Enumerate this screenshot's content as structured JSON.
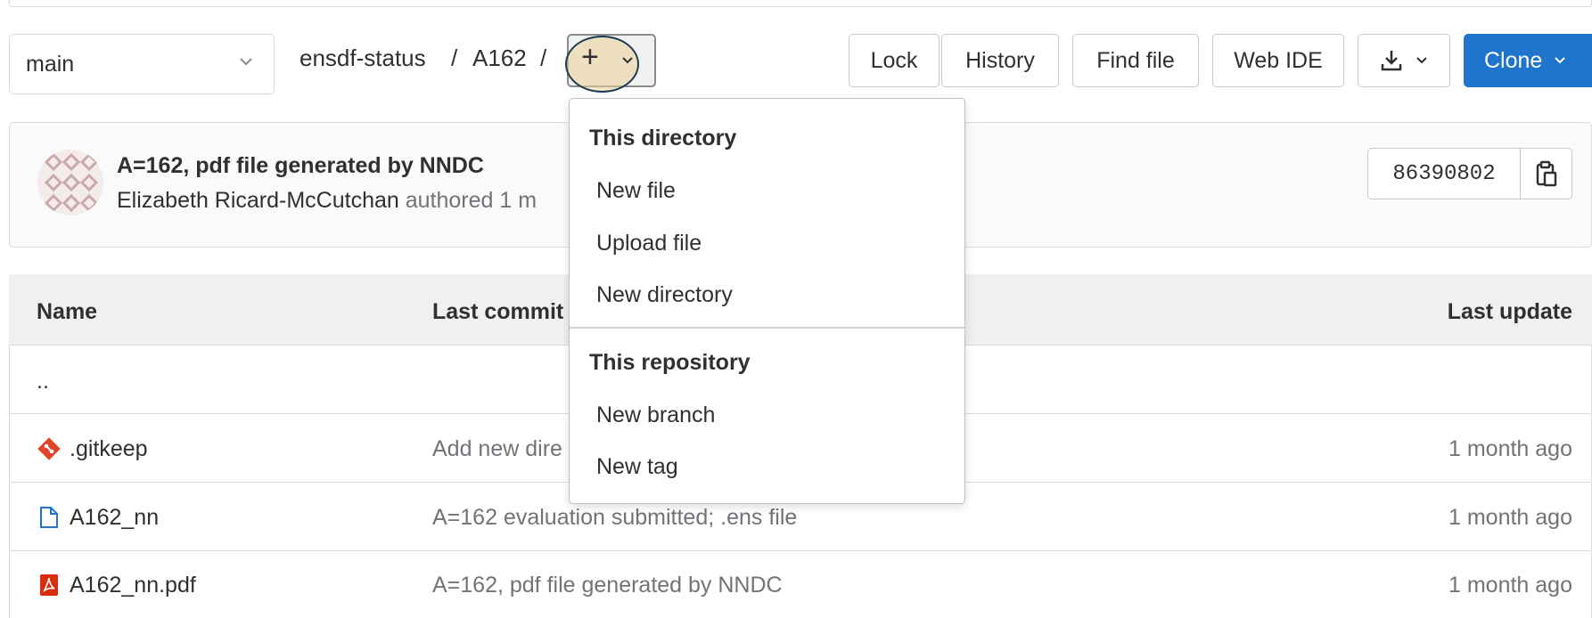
{
  "branch": {
    "name": "main"
  },
  "breadcrumb": {
    "repo": "ensdf-status",
    "sep1": "/",
    "folder": "A162",
    "sep2": "/"
  },
  "toolbar": {
    "plus_label": "+",
    "lock": "Lock",
    "history": "History",
    "find_file": "Find file",
    "web_ide": "Web IDE",
    "clone": "Clone"
  },
  "commit": {
    "title": "A=162, pdf file generated by NNDC",
    "author": "Elizabeth Ricard-McCutchan",
    "authored_text": "authored 1 m",
    "sha": "86390802"
  },
  "table": {
    "headers": {
      "name": "Name",
      "last_commit": "Last commit",
      "last_update": "Last update"
    },
    "parent_row": "..",
    "rows": [
      {
        "name": ".gitkeep",
        "commit": "Add new dire",
        "updated": "1 month ago",
        "icon": "git-icon"
      },
      {
        "name": "A162_nn",
        "commit": "A=162 evaluation submitted; .ens file",
        "updated": "1 month ago",
        "icon": "file-icon"
      },
      {
        "name": "A162_nn.pdf",
        "commit": "A=162, pdf file generated by NNDC",
        "updated": "1 month ago",
        "icon": "pdf-icon"
      }
    ]
  },
  "dropdown": {
    "section1": "This directory",
    "new_file": "New file",
    "upload_file": "Upload file",
    "new_directory": "New directory",
    "section2": "This repository",
    "new_branch": "New branch",
    "new_tag": "New tag"
  },
  "colors": {
    "accent": "#1f75cb",
    "highlight": "#ecd296",
    "git": "#e24329",
    "pdf": "#dd2b0e",
    "file": "#1f75cb"
  }
}
